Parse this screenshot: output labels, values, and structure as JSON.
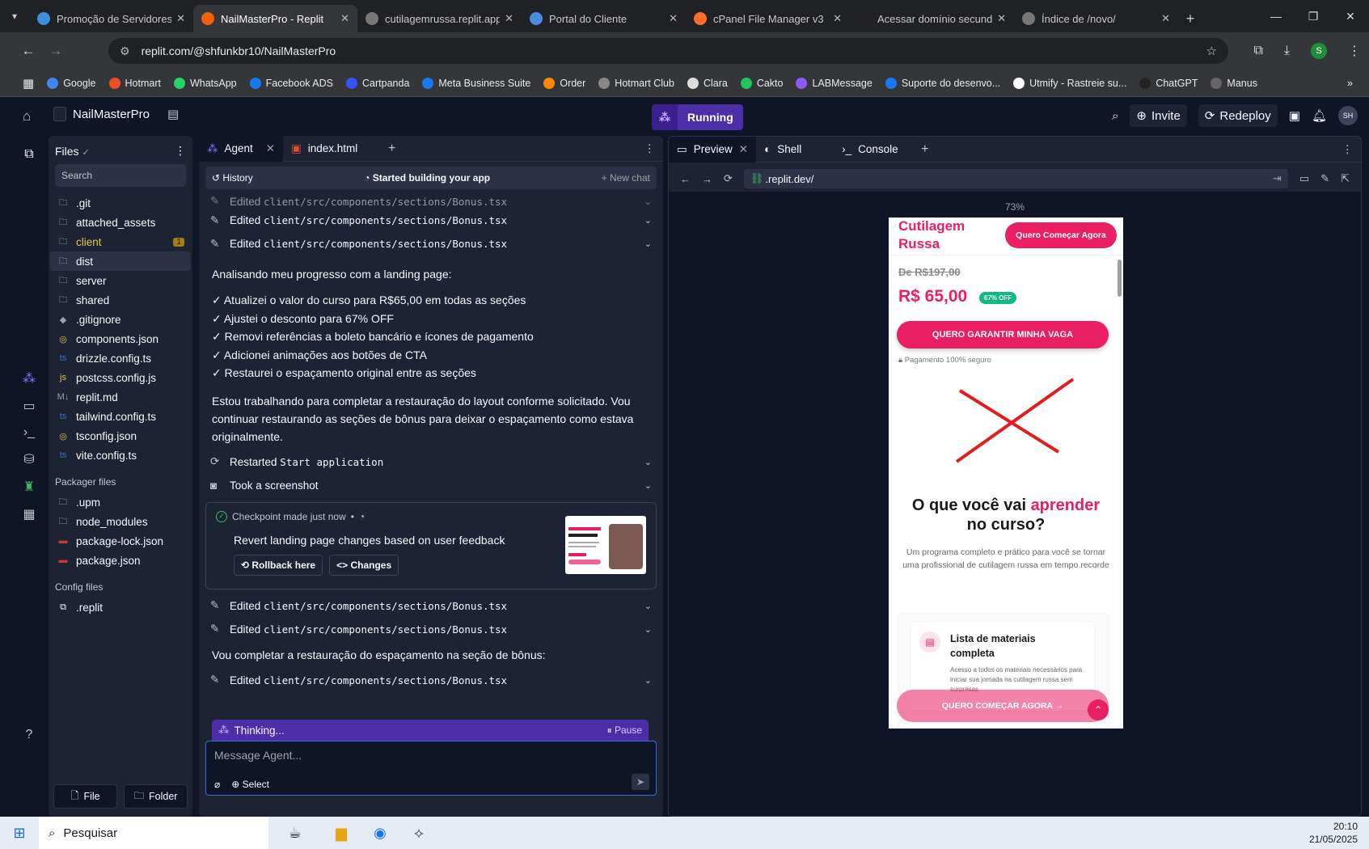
{
  "browser": {
    "tabs": [
      {
        "title": "Promoção de Servidores",
        "color": "#3e8ede",
        "active": false
      },
      {
        "title": "NailMasterPro - Replit",
        "color": "#f26207",
        "active": true
      },
      {
        "title": "cutilagemrussa.replit.app",
        "color": "#777",
        "active": false
      },
      {
        "title": "Portal do Cliente",
        "color": "#4a8de0",
        "active": false
      },
      {
        "title": "cPanel File Manager v3",
        "color": "#ff6c2c",
        "active": false
      },
      {
        "title": "Acessar domínio secunda",
        "color": "#222",
        "active": false
      },
      {
        "title": "Índice de /novo/",
        "color": "#777",
        "active": false
      }
    ],
    "url": "replit.com/@shfunkbr10/NailMasterPro",
    "profile_initial": "S",
    "bookmarks": [
      {
        "label": "Google",
        "color": "#4285f4"
      },
      {
        "label": "Hotmart",
        "color": "#f04e23"
      },
      {
        "label": "WhatsApp",
        "color": "#25d366"
      },
      {
        "label": "Facebook ADS",
        "color": "#1877f2"
      },
      {
        "label": "Cartpanda",
        "color": "#3355ff"
      },
      {
        "label": "Meta Business Suite",
        "color": "#1877f2"
      },
      {
        "label": "Order",
        "color": "#ff8800"
      },
      {
        "label": "Hotmart Club",
        "color": "#888"
      },
      {
        "label": "Clara",
        "color": "#ddd"
      },
      {
        "label": "Cakto",
        "color": "#22c55e"
      },
      {
        "label": "LABMessage",
        "color": "#8b5cf6"
      },
      {
        "label": "Suporte do desenvo...",
        "color": "#1877f2"
      },
      {
        "label": "Utmify - Rastreie su...",
        "color": "#fff"
      },
      {
        "label": "ChatGPT",
        "color": "#222"
      },
      {
        "label": "Manus",
        "color": "#666"
      }
    ]
  },
  "replit": {
    "project": "NailMasterPro",
    "status": "Running",
    "invite": "Invite",
    "redeploy": "Redeploy",
    "user_initials": "SH"
  },
  "files": {
    "title": "Files",
    "search_placeholder": "Search",
    "items": [
      {
        "name": ".git",
        "icon": "folder"
      },
      {
        "name": "attached_assets",
        "icon": "folder"
      },
      {
        "name": "client",
        "icon": "folder",
        "badge": "1",
        "color": "#e8c547"
      },
      {
        "name": "dist",
        "icon": "folder",
        "selected": true
      },
      {
        "name": "server",
        "icon": "folder"
      },
      {
        "name": "shared",
        "icon": "folder"
      },
      {
        "name": ".gitignore",
        "icon": "git"
      },
      {
        "name": "components.json",
        "icon": "json"
      },
      {
        "name": "drizzle.config.ts",
        "icon": "ts"
      },
      {
        "name": "postcss.config.js",
        "icon": "js"
      },
      {
        "name": "replit.md",
        "icon": "md"
      },
      {
        "name": "tailwind.config.ts",
        "icon": "ts"
      },
      {
        "name": "tsconfig.json",
        "icon": "json"
      },
      {
        "name": "vite.config.ts",
        "icon": "ts"
      }
    ],
    "packager_title": "Packager files",
    "packager": [
      {
        "name": ".upm",
        "icon": "folder"
      },
      {
        "name": "node_modules",
        "icon": "folder"
      },
      {
        "name": "package-lock.json",
        "icon": "npm"
      },
      {
        "name": "package.json",
        "icon": "npm"
      }
    ],
    "config_title": "Config files",
    "config": [
      {
        "name": ".replit",
        "icon": "replit"
      }
    ],
    "new_file": "File",
    "new_folder": "Folder"
  },
  "agent": {
    "tab_agent": "Agent",
    "tab_index": "index.html",
    "history": "History",
    "status": "Started building your app",
    "new_chat": "+ New chat",
    "edit_path": "client/src/components/sections/Bonus.tsx",
    "edited": "Edited",
    "intro": "Analisando meu progresso com a landing page:",
    "checks": [
      "✓ Atualizei o valor do curso para R$65,00 em todas as seções",
      "✓ Ajustei o desconto para 67% OFF",
      "✓ Removi referências a boleto bancário e ícones de pagamento",
      "✓ Adicionei animações aos botões de CTA",
      "✓ Restaurei o espaçamento original entre as seções"
    ],
    "para2": "Estou trabalhando para completar a restauração do layout conforme solicitado. Vou continuar restaurando as seções de bônus para deixar o espaçamento como estava originalmente.",
    "restarted": "Restarted",
    "restarted_code": "Start application",
    "screenshot": "Took a screenshot",
    "checkpoint": "Checkpoint made just now",
    "checkpoint_title": "Revert landing page changes based on user feedback",
    "rollback": "Rollback here",
    "changes": "Changes",
    "para3": "Vou completar a restauração do espaçamento na seção de bônus:",
    "thinking": "Thinking...",
    "pause": "Pause",
    "msg_placeholder": "Message Agent...",
    "select": "Select"
  },
  "preview": {
    "tab_preview": "Preview",
    "tab_shell": "Shell",
    "tab_console": "Console",
    "url": ".replit.dev/",
    "zoom": "73%",
    "site": {
      "brand": "Cutilagem Russa",
      "cta_top": "Quero Começar Agora",
      "old_price": "De R$197,00",
      "price": "R$ 65,00",
      "discount": "67% OFF",
      "cta_main": "QUERO GARANTIR MINHA VAGA",
      "secure": "Pagamento 100% seguro",
      "heading_a": "O que você vai ",
      "heading_b": "aprender",
      "heading_c": "no curso?",
      "sub": "Um programa completo e prático para você se tornar uma profissional de cutilagem russa em tempo recorde",
      "card_title": "Lista de materiais completa",
      "card_text": "Acesso a todos os materiais necessários para iniciar sua jornada na cutilagem russa sem surpresas.",
      "sticky_cta": "QUERO COMEÇAR AGORA →"
    }
  },
  "taskbar": {
    "search": "Pesquisar",
    "time": "20:10",
    "date": "21/05/2025"
  }
}
